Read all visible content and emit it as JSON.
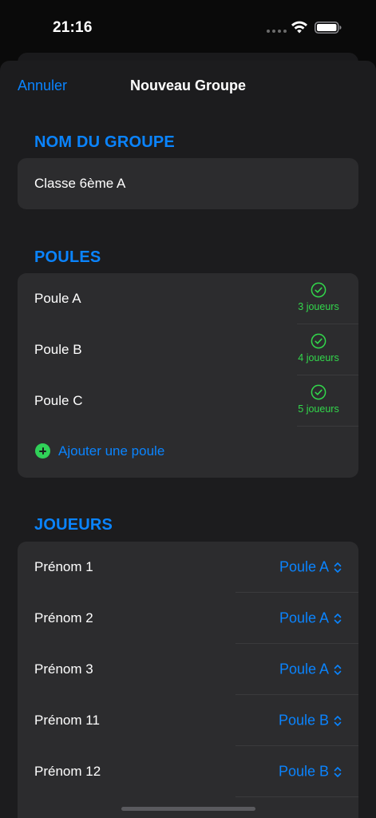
{
  "status_bar": {
    "time": "21:16"
  },
  "nav": {
    "cancel_label": "Annuler",
    "title": "Nouveau Groupe"
  },
  "group_name": {
    "header": "NOM DU GROUPE",
    "value": "Classe 6ème A"
  },
  "pools": {
    "header": "POULES",
    "items": [
      {
        "name": "Poule A",
        "count": "3 joueurs"
      },
      {
        "name": "Poule B",
        "count": "4 joueurs"
      },
      {
        "name": "Poule C",
        "count": "5 joueurs"
      }
    ],
    "add_label": "Ajouter une poule"
  },
  "players": {
    "header": "JOUEURS",
    "items": [
      {
        "name": "Prénom 1",
        "pool": "Poule A"
      },
      {
        "name": "Prénom 2",
        "pool": "Poule A"
      },
      {
        "name": "Prénom 3",
        "pool": "Poule A"
      },
      {
        "name": "Prénom 11",
        "pool": "Poule B"
      },
      {
        "name": "Prénom 12",
        "pool": "Poule B"
      }
    ]
  },
  "colors": {
    "accent": "#0a84ff",
    "success": "#32d74b",
    "background": "#1c1c1e",
    "card": "#2c2c2e"
  },
  "icons": [
    "wifi-icon",
    "battery-icon",
    "checkmark-circle-icon",
    "plus-circle-icon",
    "chevron-updown-icon"
  ]
}
